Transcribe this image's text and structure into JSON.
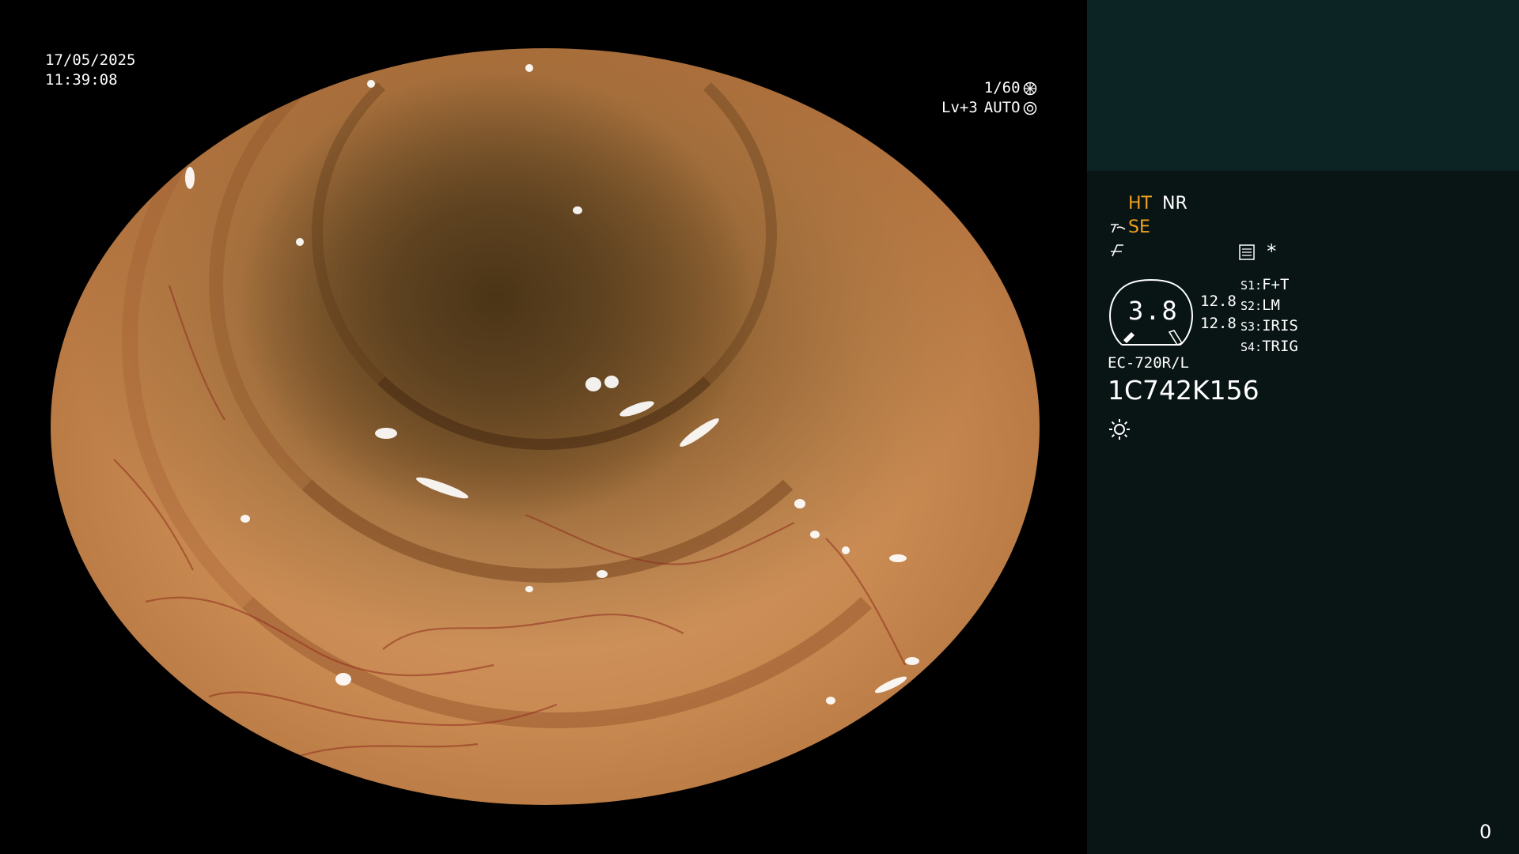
{
  "image": {
    "date": "17/05/2025",
    "time": "11:39:08",
    "shutter": "1/60",
    "level": "Lv+3",
    "iris_mode": "AUTO"
  },
  "panel": {
    "ht_label": "HT",
    "nr_label": "NR",
    "se_label": "SE",
    "star_label": "*",
    "zoom_value": "3.8",
    "value_a": "12.8",
    "value_b": "12.8",
    "s1_key": "S1:",
    "s1_value": "F+T",
    "s2_key": "S2:",
    "s2_value": "LM",
    "s3_key": "S3:",
    "s3_value": "IRIS",
    "s4_key": "S4:",
    "s4_value": "TRIG",
    "scope_model": "EC-720R/L",
    "serial": "1C742K156",
    "counter": "0"
  },
  "colors": {
    "accent_orange": "#f0a020",
    "panel_bg": "#081514",
    "panel_top_bg": "#0c2424"
  },
  "icons": [
    "shutter-icon",
    "iris-icon",
    "structure-icon",
    "color-enhance-icon",
    "memo-icon",
    "light-icon"
  ]
}
